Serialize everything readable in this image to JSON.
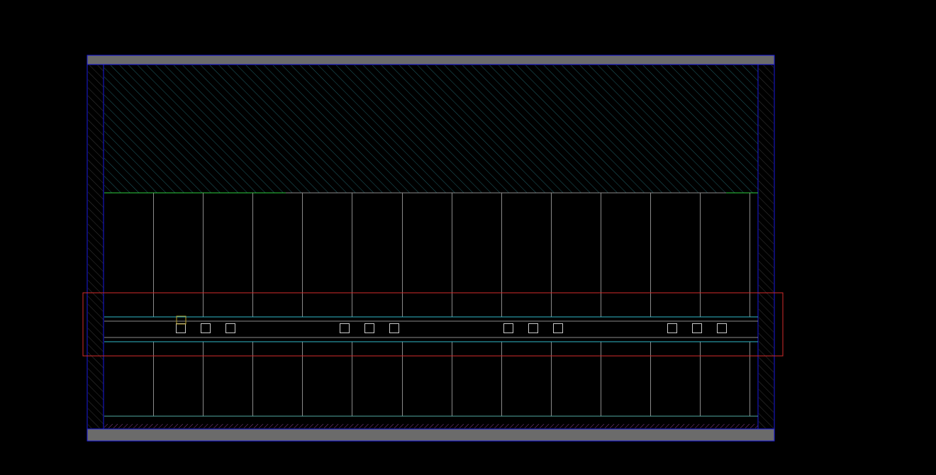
{
  "colors": {
    "background": "#000000",
    "frame_outline": "#1a1adf",
    "frame_bar": "#6b6b6b",
    "hatch": "#1f5f66",
    "hatch_side": "#3a3a3a",
    "partition": "#8a8a8a",
    "rail": "#2fb7c9",
    "ledge": "#2ecc40",
    "selection": "#d42b2b",
    "marker": "#c8c8c8",
    "marker_accent": "#b8a02a",
    "floor_line": "#4fa8a0",
    "floor_hatch": "#8a3a8a"
  },
  "icons": {
    "top_hatch": "diagonal-hatch-pattern",
    "side_hatch": "diagonal-hatch-pattern",
    "markers": "square-outline"
  },
  "layout": {
    "partition_count": 13,
    "marker_groups": 4,
    "markers_per_group": 3
  }
}
